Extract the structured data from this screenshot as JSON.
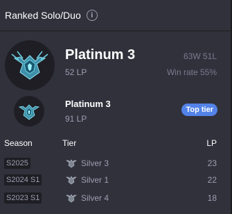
{
  "header": {
    "title": "Ranked Solo/Duo",
    "info_icon": "i"
  },
  "current": {
    "tier": "Platinum 3",
    "lp": "52 LP",
    "record": "63W 51L",
    "win_rate": "Win rate 55%",
    "emblem": "platinum-emblem-icon"
  },
  "peak": {
    "tier": "Platinum 3",
    "lp": "91 LP",
    "badge": "Top tier",
    "emblem": "platinum-emblem-icon"
  },
  "table": {
    "headers": {
      "season": "Season",
      "tier": "Tier",
      "lp": "LP"
    },
    "rows": [
      {
        "season": "S2025",
        "tier": "Silver 3",
        "lp": "23",
        "emblem": "silver-emblem-icon"
      },
      {
        "season": "S2024 S1",
        "tier": "Silver 1",
        "lp": "22",
        "emblem": "silver-emblem-icon"
      },
      {
        "season": "S2023 S1",
        "tier": "Silver 4",
        "lp": "18",
        "emblem": "silver-emblem-icon"
      }
    ]
  },
  "colors": {
    "background": "#31313c",
    "accent": "#5383e8",
    "muted_text": "#9e9eb1",
    "platinum": "#4fc3d8"
  }
}
